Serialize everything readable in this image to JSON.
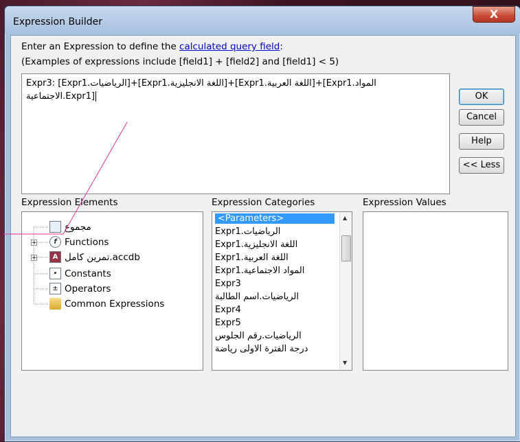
{
  "window": {
    "title": "Expression Builder",
    "close_glyph": "X"
  },
  "instructions": {
    "line1_prefix": "Enter an Expression to define the ",
    "line1_link": "calculated query field",
    "line1_suffix": ":",
    "line2": "(Examples of expressions include [field1] + [field2] and [field1] < 5)"
  },
  "expression": {
    "line1": "Expr3: [Expr1.الرياضيات]+[Expr1.اللغة الانجليزية]+[Expr1.اللغة العربية]+[Expr1.المواد",
    "line2": "الاجتماعية.Expr1]"
  },
  "buttons": {
    "ok": "OK",
    "cancel": "Cancel",
    "help": "Help",
    "less": "<< Less"
  },
  "sections": {
    "elements": "Expression Elements",
    "categories": "Expression Categories",
    "values": "Expression Values"
  },
  "elements_tree": [
    {
      "label": "مجموع",
      "icon": "form-icon",
      "expandable": false
    },
    {
      "label": "Functions",
      "icon": "function-icon",
      "expandable": true
    },
    {
      "label": "تمرين كامل.accdb",
      "icon": "database-icon",
      "expandable": true
    },
    {
      "label": "Constants",
      "icon": "constants-icon",
      "expandable": false
    },
    {
      "label": "Operators",
      "icon": "operators-icon",
      "expandable": false
    },
    {
      "label": "Common Expressions",
      "icon": "common-expressions-icon",
      "expandable": false
    }
  ],
  "categories_list": [
    "<Parameters>",
    "Expr1.الرياضيات",
    "Expr1.اللغة الانجليزية",
    "Expr1.اللغة العربية",
    "Expr1.المواد الاجتماعية",
    "Expr3",
    "الرياضيات.اسم الطالبة",
    "Expr4",
    "Expr5",
    "الرياضيات.رقم الجلوس",
    "درجة الفترة الاولى رياضة"
  ],
  "selected_category": "<Parameters>",
  "colors": {
    "selection": "#3399ff",
    "link": "#0000cc",
    "titlebar": "#a8c1df",
    "pointer_line": "#e0309a"
  }
}
